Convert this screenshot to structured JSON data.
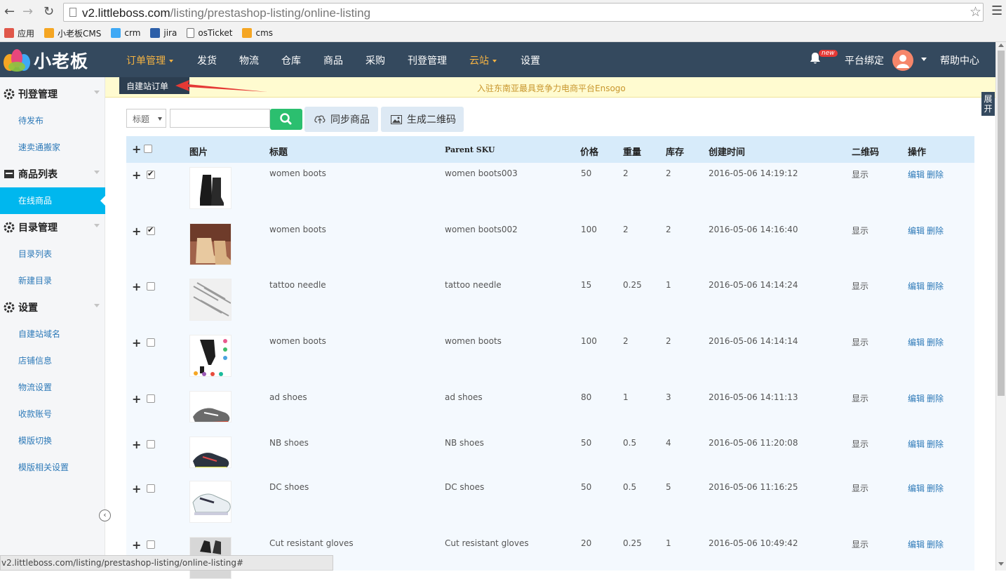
{
  "browser": {
    "url_host": "v2.littleboss.com",
    "url_path": "/listing/prestashop-listing/online-listing",
    "bookmarks": [
      {
        "label": "应用",
        "icon": "apps-icon"
      },
      {
        "label": "小老板CMS",
        "icon": "littleboss-icon"
      },
      {
        "label": "crm",
        "icon": "windows-icon"
      },
      {
        "label": "jira",
        "icon": "jira-icon"
      },
      {
        "label": "osTicket",
        "icon": "page-icon"
      },
      {
        "label": "cms",
        "icon": "littleboss-icon"
      }
    ],
    "status_url": "v2.littleboss.com/listing/prestashop-listing/online-listing#"
  },
  "header": {
    "logo_text": "小老板",
    "nav": [
      {
        "label": "订单管理",
        "dropdown": true,
        "active": true
      },
      {
        "label": "发货"
      },
      {
        "label": "物流"
      },
      {
        "label": "仓库"
      },
      {
        "label": "商品"
      },
      {
        "label": "采购"
      },
      {
        "label": "刊登管理"
      },
      {
        "label": "云站",
        "dropdown": true,
        "active": true
      },
      {
        "label": "设置"
      }
    ],
    "badge": "new",
    "platform_bind": "平台绑定",
    "help": "帮助中心",
    "accent_color": "#f5b342"
  },
  "dropdown": {
    "item": "自建站订单"
  },
  "announcement": "入驻东南亚最具竞争力电商平台Ensogo",
  "expand_label": "展开",
  "sidebar": {
    "sections": [
      {
        "label": "刊登管理",
        "icon": "gear-icon",
        "items": [
          "待发布",
          "速卖通搬家"
        ]
      },
      {
        "label": "商品列表",
        "icon": "box-icon",
        "items": [
          "在线商品"
        ]
      },
      {
        "label": "目录管理",
        "icon": "gear-icon",
        "items": [
          "目录列表",
          "新建目录"
        ]
      },
      {
        "label": "设置",
        "icon": "gear-icon",
        "items": [
          "自建站域名",
          "店铺信息",
          "物流设置",
          "收款账号",
          "模版切换",
          "模版相关设置"
        ]
      }
    ],
    "active_item": "在线商品",
    "active_color": "#00b7ee"
  },
  "toolbar": {
    "select_value": "标题",
    "search_value": "",
    "sync_label": "同步商品",
    "qrcode_label": "生成二维码"
  },
  "table": {
    "columns": [
      "图片",
      "标题",
      "Parent SKU",
      "价格",
      "重量",
      "库存",
      "创建时间",
      "二维码",
      "操作"
    ],
    "rows": [
      {
        "checked": true,
        "title": "women boots",
        "sku": "women boots003",
        "price": "50",
        "weight": "2",
        "stock": "2",
        "created": "2016-05-06 14:19:12",
        "qr": "显示",
        "edit": "编辑",
        "del": "删除",
        "thumb": "boots-black"
      },
      {
        "checked": true,
        "title": "women boots",
        "sku": "women boots002",
        "price": "100",
        "weight": "2",
        "stock": "2",
        "created": "2016-05-06 14:16:40",
        "qr": "显示",
        "edit": "编辑",
        "del": "删除",
        "thumb": "boots-tan"
      },
      {
        "checked": false,
        "title": "tattoo needle",
        "sku": "tattoo needle",
        "price": "15",
        "weight": "0.25",
        "stock": "1",
        "created": "2016-05-06 14:14:24",
        "qr": "显示",
        "edit": "编辑",
        "del": "删除",
        "thumb": "needles"
      },
      {
        "checked": false,
        "title": "women boots",
        "sku": "women boots",
        "price": "100",
        "weight": "2",
        "stock": "2",
        "created": "2016-05-06 14:14:14",
        "qr": "显示",
        "edit": "编辑",
        "del": "删除",
        "thumb": "boots-heel"
      },
      {
        "checked": false,
        "title": "ad shoes",
        "sku": "ad shoes",
        "price": "80",
        "weight": "1",
        "stock": "3",
        "created": "2016-05-06 14:11:13",
        "qr": "显示",
        "edit": "编辑",
        "del": "删除",
        "thumb": "shoe-gray"
      },
      {
        "checked": false,
        "title": "NB shoes",
        "sku": "NB shoes",
        "price": "50",
        "weight": "0.5",
        "stock": "4",
        "created": "2016-05-06 11:20:08",
        "qr": "显示",
        "edit": "编辑",
        "del": "删除",
        "thumb": "shoe-dark"
      },
      {
        "checked": false,
        "title": "DC shoes",
        "sku": "DC shoes",
        "price": "50",
        "weight": "0.5",
        "stock": "5",
        "created": "2016-05-06 11:16:25",
        "qr": "显示",
        "edit": "编辑",
        "del": "删除",
        "thumb": "shoe-white"
      },
      {
        "checked": false,
        "title": "Cut resistant gloves",
        "sku": "Cut resistant gloves",
        "price": "20",
        "weight": "0.25",
        "stock": "1",
        "created": "2016-05-06 10:49:42",
        "qr": "显示",
        "edit": "编辑",
        "del": "删除",
        "thumb": "gloves"
      }
    ]
  }
}
